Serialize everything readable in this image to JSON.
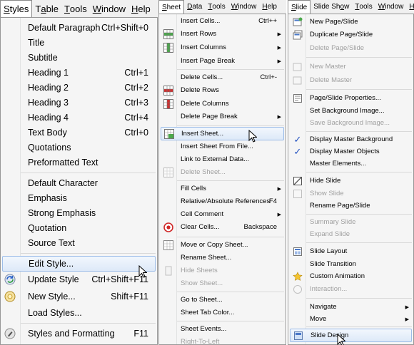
{
  "styles_panel": {
    "menubar": [
      {
        "pre": "",
        "u": "S",
        "post": "tyles"
      },
      {
        "pre": "T",
        "u": "a",
        "post": "ble"
      },
      {
        "pre": "",
        "u": "T",
        "post": "ools"
      },
      {
        "pre": "",
        "u": "W",
        "post": "indow"
      },
      {
        "pre": "",
        "u": "H",
        "post": "elp"
      }
    ],
    "items": {
      "default_paragraph": {
        "label": "Default Paragraph",
        "shortcut": "Ctrl+Shift+0"
      },
      "title": {
        "label": "Title"
      },
      "subtitle": {
        "label": "Subtitle"
      },
      "heading1": {
        "label": "Heading 1",
        "shortcut": "Ctrl+1"
      },
      "heading2": {
        "label": "Heading 2",
        "shortcut": "Ctrl+2"
      },
      "heading3": {
        "label": "Heading 3",
        "shortcut": "Ctrl+3"
      },
      "heading4": {
        "label": "Heading 4",
        "shortcut": "Ctrl+4"
      },
      "text_body": {
        "label": "Text Body",
        "shortcut": "Ctrl+0"
      },
      "quotations": {
        "label": "Quotations"
      },
      "preformatted_text": {
        "label": "Preformatted Text"
      },
      "default_character": {
        "label": "Default Character"
      },
      "emphasis": {
        "label": "Emphasis"
      },
      "strong_emphasis": {
        "label": "Strong Emphasis"
      },
      "quotation": {
        "label": "Quotation"
      },
      "source_text": {
        "label": "Source Text"
      },
      "edit_style": {
        "label": "Edit Style..."
      },
      "update_style": {
        "label": "Update Style",
        "shortcut": "Ctrl+Shift+F11"
      },
      "new_style": {
        "label": "New Style...",
        "shortcut": "Shift+F11"
      },
      "load_styles": {
        "label": "Load Styles..."
      },
      "styles_and_formatting": {
        "label": "Styles and Formatting",
        "shortcut": "F11"
      }
    }
  },
  "sheet_panel": {
    "menubar": [
      {
        "pre": "",
        "u": "S",
        "post": "heet"
      },
      {
        "pre": "",
        "u": "D",
        "post": "ata"
      },
      {
        "pre": "",
        "u": "T",
        "post": "ools"
      },
      {
        "pre": "",
        "u": "W",
        "post": "indow"
      },
      {
        "pre": "",
        "u": "H",
        "post": "elp"
      }
    ],
    "items": {
      "insert_cells": {
        "label": "Insert Cells...",
        "shortcut": "Ctrl++"
      },
      "insert_rows": {
        "label": "Insert Rows"
      },
      "insert_columns": {
        "label": "Insert Columns"
      },
      "insert_page_break": {
        "label": "Insert Page Break"
      },
      "delete_cells": {
        "label": "Delete Cells...",
        "shortcut": "Ctrl+-"
      },
      "delete_rows": {
        "label": "Delete Rows"
      },
      "delete_columns": {
        "label": "Delete Columns"
      },
      "delete_page_break": {
        "label": "Delete Page Break"
      },
      "insert_sheet": {
        "label": "Insert Sheet..."
      },
      "insert_sheet_from_file": {
        "label": "Insert Sheet From File..."
      },
      "link_external": {
        "label": "Link to External Data..."
      },
      "delete_sheet": {
        "label": "Delete Sheet..."
      },
      "fill_cells": {
        "label": "Fill Cells"
      },
      "relative_absolute": {
        "label": "Relative/Absolute References",
        "shortcut": "F4"
      },
      "cell_comment": {
        "label": "Cell Comment"
      },
      "clear_cells": {
        "label": "Clear Cells...",
        "shortcut": "Backspace"
      },
      "move_copy_sheet": {
        "label": "Move or Copy Sheet..."
      },
      "rename_sheet": {
        "label": "Rename Sheet..."
      },
      "hide_sheets": {
        "label": "Hide Sheets"
      },
      "show_sheet": {
        "label": "Show Sheet..."
      },
      "go_to_sheet": {
        "label": "Go to Sheet..."
      },
      "sheet_tab_color": {
        "label": "Sheet Tab Color..."
      },
      "sheet_events": {
        "label": "Sheet Events..."
      },
      "right_to_left": {
        "label": "Right-To-Left"
      }
    }
  },
  "slide_panel": {
    "menubar": [
      {
        "pre": "",
        "u": "S",
        "post": "lide"
      },
      {
        "pre": "Slide Sh",
        "u": "o",
        "post": "w"
      },
      {
        "pre": "",
        "u": "T",
        "post": "ools"
      },
      {
        "pre": "",
        "u": "W",
        "post": "indow"
      },
      {
        "pre": "",
        "u": "H",
        "post": "elp"
      }
    ],
    "items": {
      "new_page_slide": {
        "label": "New Page/Slide"
      },
      "duplicate_page_slide": {
        "label": "Duplicate Page/Slide"
      },
      "delete_page_slide": {
        "label": "Delete Page/Slide"
      },
      "new_master": {
        "label": "New Master"
      },
      "delete_master": {
        "label": "Delete Master"
      },
      "page_slide_properties": {
        "label": "Page/Slide Properties..."
      },
      "set_background_image": {
        "label": "Set Background Image..."
      },
      "save_background_image": {
        "label": "Save Background Image..."
      },
      "display_master_background": {
        "label": "Display Master Background"
      },
      "display_master_objects": {
        "label": "Display Master Objects"
      },
      "master_elements": {
        "label": "Master Elements..."
      },
      "hide_slide": {
        "label": "Hide Slide"
      },
      "show_slide": {
        "label": "Show Slide"
      },
      "rename_page_slide": {
        "label": "Rename Page/Slide"
      },
      "summary_slide": {
        "label": "Summary Slide"
      },
      "expand_slide": {
        "label": "Expand Slide"
      },
      "slide_layout": {
        "label": "Slide Layout"
      },
      "slide_transition": {
        "label": "Slide Transition"
      },
      "custom_animation": {
        "label": "Custom Animation"
      },
      "interaction": {
        "label": "Interaction..."
      },
      "navigate": {
        "label": "Navigate"
      },
      "move": {
        "label": "Move"
      },
      "slide_design": {
        "label": "Slide Design"
      }
    },
    "check_mark": "✓"
  },
  "glyphs": {
    "submenu_arrow": "▶"
  },
  "colors": {
    "highlight_border": "#9dbde8",
    "disabled_text": "#a0a0a0",
    "check_blue": "#2050c0"
  }
}
